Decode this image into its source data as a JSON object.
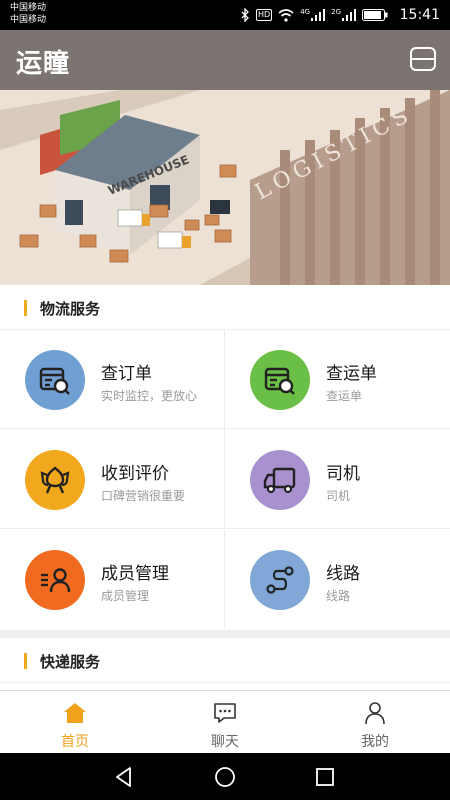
{
  "status_bar": {
    "carrier_1": "中国移动",
    "carrier_2": "中国移动",
    "network_4g": "4G",
    "network_2g": "2G",
    "badge": "HD",
    "time": "15:41",
    "icons": [
      "bluetooth-icon",
      "hd-icon",
      "wifi-icon",
      "signal-icon",
      "signal-icon",
      "battery-icon"
    ]
  },
  "app_bar": {
    "logo": "运瞳",
    "menu_icon": "scan-frame-icon",
    "color": "#7b7470"
  },
  "banner": {
    "warehouse_sign": "WAREHOUSE",
    "logistics_text": "LOGISTICS"
  },
  "section_logistics": {
    "title": "物流服务",
    "accent": "#f2a81d",
    "items": [
      {
        "title": "查订单",
        "subtitle": "实时监控，更放心",
        "icon": "order-search-icon",
        "color": "#6f9fd3"
      },
      {
        "title": "查运单",
        "subtitle": "查运单",
        "icon": "waybill-search-icon",
        "color": "#6abf46"
      },
      {
        "title": "收到评价",
        "subtitle": "口碑营销很重要",
        "icon": "flower-review-icon",
        "color": "#f2a81d"
      },
      {
        "title": "司机",
        "subtitle": "司机",
        "icon": "truck-icon",
        "color": "#a991cf"
      },
      {
        "title": "成员管理",
        "subtitle": "成员管理",
        "icon": "member-icon",
        "color": "#f06a1f"
      },
      {
        "title": "线路",
        "subtitle": "线路",
        "icon": "route-icon",
        "color": "#80a7d8"
      }
    ]
  },
  "section_express": {
    "title": "快递服务"
  },
  "tab_bar": {
    "active_color": "#f0a21c",
    "tabs": [
      {
        "label": "首页",
        "icon": "home-icon",
        "active": true
      },
      {
        "label": "聊天",
        "icon": "chat-icon",
        "active": false
      },
      {
        "label": "我的",
        "icon": "user-icon",
        "active": false
      }
    ]
  },
  "nav_bar": {
    "buttons": [
      "back-icon",
      "home-circle-icon",
      "recents-icon"
    ]
  }
}
